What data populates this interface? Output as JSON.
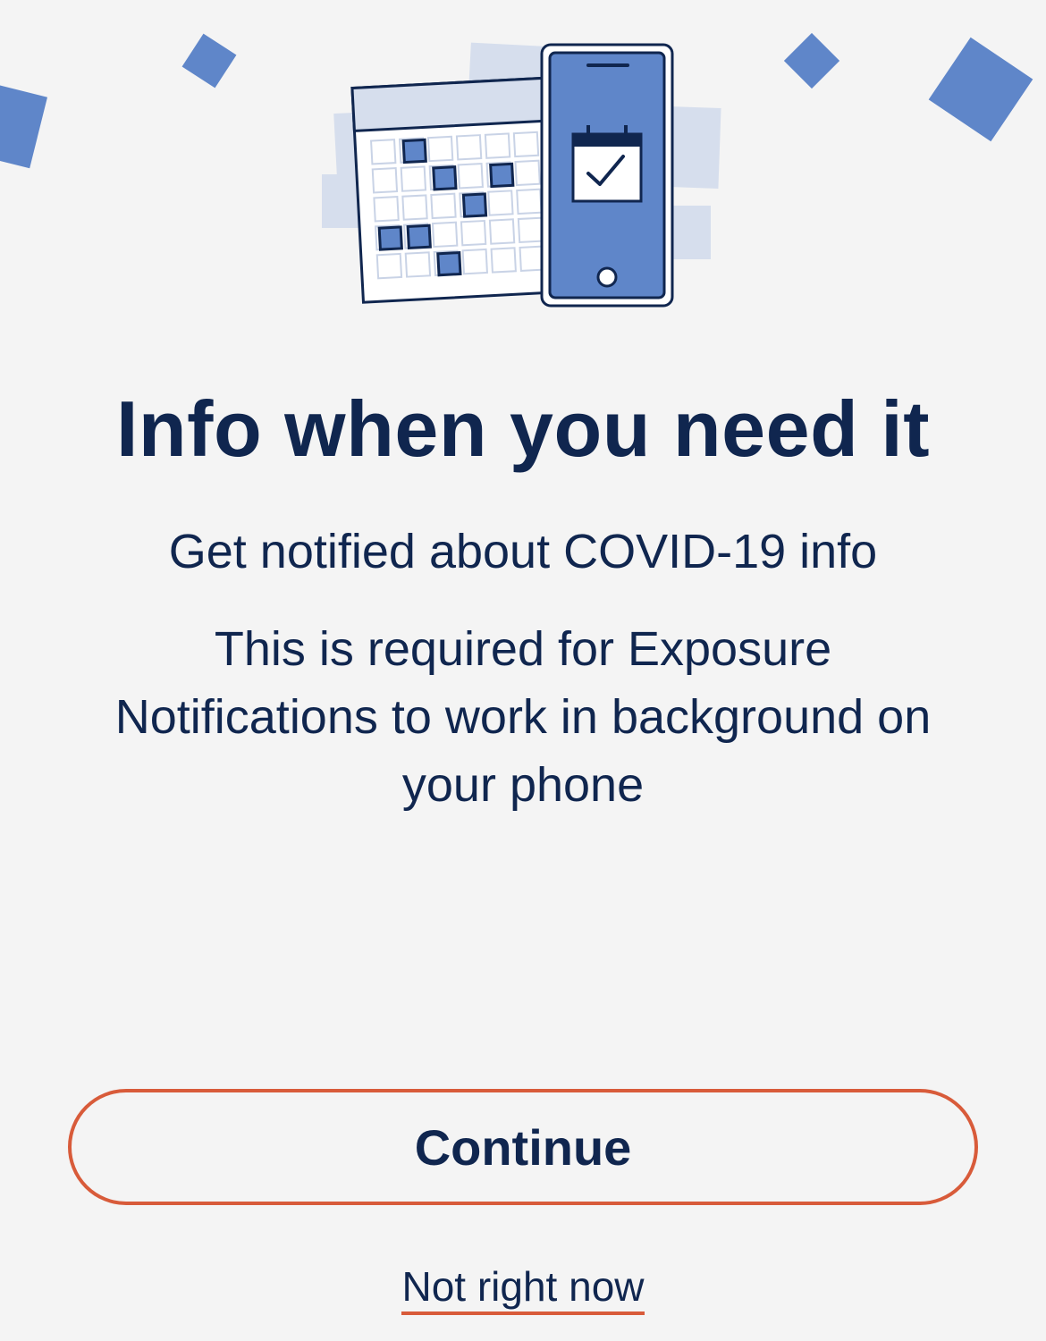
{
  "colors": {
    "background": "#f4f4f4",
    "text": "#10264f",
    "accent_blue": "#5f86c9",
    "light_blue": "#d6deed",
    "outline_orange": "#d85b3a"
  },
  "hero": {
    "illustration_name": "calendar-and-phone-illustration",
    "icons": [
      "calendar-icon",
      "phone-icon",
      "calendar-check-icon"
    ]
  },
  "content": {
    "title": "Info when you need it",
    "subtitle": "Get notified about COVID-19 info",
    "description": "This is required for Exposure Notifications to work in background on your phone"
  },
  "actions": {
    "continue_label": "Continue",
    "not_now_label": "Not right now"
  }
}
